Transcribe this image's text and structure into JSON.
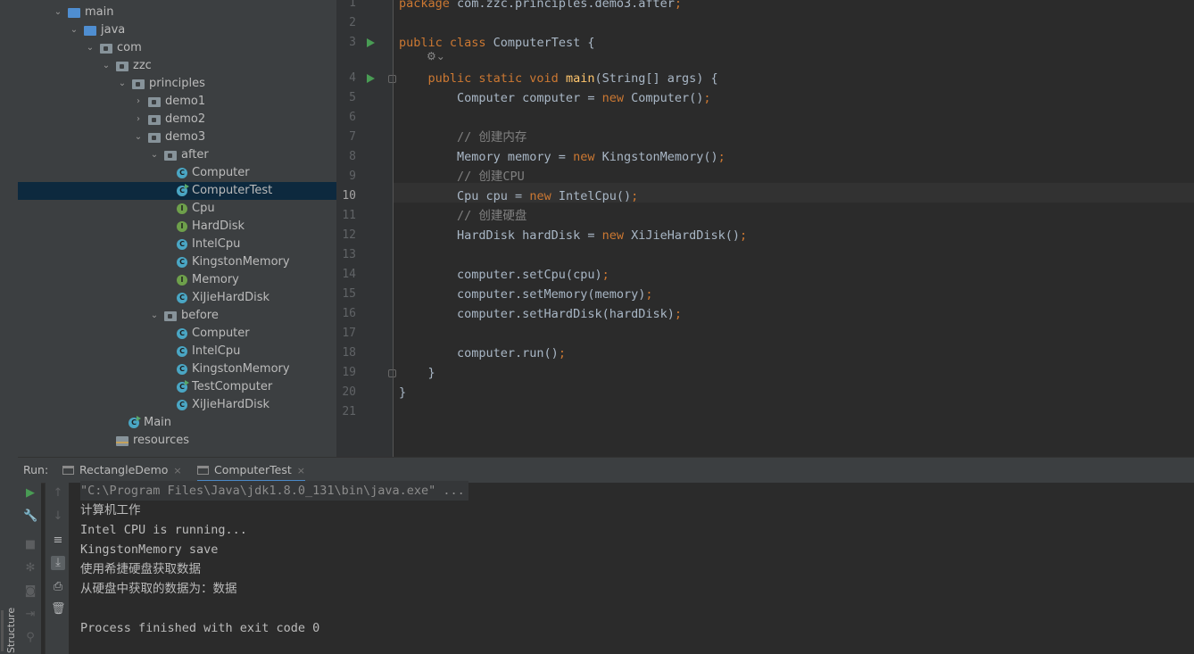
{
  "project_tree": {
    "items": [
      {
        "label": "main",
        "kind": "folder-src",
        "depth": 0,
        "state": "open"
      },
      {
        "label": "java",
        "kind": "folder-src",
        "depth": 1,
        "state": "open"
      },
      {
        "label": "com",
        "kind": "folder-pkg",
        "depth": 2,
        "state": "open"
      },
      {
        "label": "zzc",
        "kind": "folder-pkg",
        "depth": 3,
        "state": "open"
      },
      {
        "label": "principles",
        "kind": "folder-pkg",
        "depth": 4,
        "state": "open"
      },
      {
        "label": "demo1",
        "kind": "folder-pkg",
        "depth": 5,
        "state": "closed"
      },
      {
        "label": "demo2",
        "kind": "folder-pkg",
        "depth": 5,
        "state": "closed"
      },
      {
        "label": "demo3",
        "kind": "folder-pkg",
        "depth": 5,
        "state": "open"
      },
      {
        "label": "after",
        "kind": "folder-pkg",
        "depth": 6,
        "state": "open"
      },
      {
        "label": "Computer",
        "kind": "class",
        "depth": 7
      },
      {
        "label": "ComputerTest",
        "kind": "class-run",
        "depth": 7,
        "selected": true
      },
      {
        "label": "Cpu",
        "kind": "interface",
        "depth": 7
      },
      {
        "label": "HardDisk",
        "kind": "interface",
        "depth": 7
      },
      {
        "label": "IntelCpu",
        "kind": "class",
        "depth": 7
      },
      {
        "label": "KingstonMemory",
        "kind": "class",
        "depth": 7
      },
      {
        "label": "Memory",
        "kind": "interface",
        "depth": 7
      },
      {
        "label": "XiJieHardDisk",
        "kind": "class",
        "depth": 7
      },
      {
        "label": "before",
        "kind": "folder-pkg",
        "depth": 6,
        "state": "open"
      },
      {
        "label": "Computer",
        "kind": "class",
        "depth": 7
      },
      {
        "label": "IntelCpu",
        "kind": "class",
        "depth": 7
      },
      {
        "label": "KingstonMemory",
        "kind": "class",
        "depth": 7
      },
      {
        "label": "TestComputer",
        "kind": "class-run",
        "depth": 7
      },
      {
        "label": "XiJieHardDisk",
        "kind": "class",
        "depth": 7
      },
      {
        "label": "Main",
        "kind": "class-run",
        "depth": 4
      },
      {
        "label": "resources",
        "kind": "folder-res",
        "depth": 3
      }
    ]
  },
  "editor": {
    "current_line": 10,
    "lines": [
      {
        "n": "1",
        "tokens": [
          [
            "kw",
            "package "
          ],
          [
            "pl",
            "com.zzc.principles.demo3.after"
          ],
          [
            "sm",
            ";"
          ]
        ]
      },
      {
        "n": "2",
        "tokens": []
      },
      {
        "n": "3",
        "tokens": [
          [
            "kw",
            "public class "
          ],
          [
            "pl",
            "ComputerTest {"
          ]
        ]
      },
      {
        "n": "",
        "tokens": []
      },
      {
        "n": "4",
        "tokens": [
          [
            "pl",
            "    "
          ],
          [
            "kw",
            "public static void "
          ],
          [
            "fn",
            "main"
          ],
          [
            "pl",
            "(String[] args) {"
          ]
        ]
      },
      {
        "n": "5",
        "tokens": [
          [
            "pl",
            "        Computer computer = "
          ],
          [
            "kw",
            "new "
          ],
          [
            "pl",
            "Computer()"
          ],
          [
            "sm",
            ";"
          ]
        ]
      },
      {
        "n": "6",
        "tokens": []
      },
      {
        "n": "7",
        "tokens": [
          [
            "cm",
            "        // 创建内存"
          ]
        ]
      },
      {
        "n": "8",
        "tokens": [
          [
            "pl",
            "        Memory memory = "
          ],
          [
            "kw",
            "new "
          ],
          [
            "pl",
            "KingstonMemory()"
          ],
          [
            "sm",
            ";"
          ]
        ]
      },
      {
        "n": "9",
        "tokens": [
          [
            "cm",
            "        // 创建CPU"
          ]
        ]
      },
      {
        "n": "10",
        "tokens": [
          [
            "pl",
            "        Cpu cpu = "
          ],
          [
            "kw",
            "new "
          ],
          [
            "pl",
            "IntelCpu()"
          ],
          [
            "sm",
            ";"
          ]
        ]
      },
      {
        "n": "11",
        "tokens": [
          [
            "cm",
            "        // 创建硬盘"
          ]
        ]
      },
      {
        "n": "12",
        "tokens": [
          [
            "pl",
            "        HardDisk hardDisk = "
          ],
          [
            "kw",
            "new "
          ],
          [
            "pl",
            "XiJieHardDisk()"
          ],
          [
            "sm",
            ";"
          ]
        ]
      },
      {
        "n": "13",
        "tokens": []
      },
      {
        "n": "14",
        "tokens": [
          [
            "pl",
            "        computer.setCpu(cpu)"
          ],
          [
            "sm",
            ";"
          ]
        ]
      },
      {
        "n": "15",
        "tokens": [
          [
            "pl",
            "        computer.setMemory(memory)"
          ],
          [
            "sm",
            ";"
          ]
        ]
      },
      {
        "n": "16",
        "tokens": [
          [
            "pl",
            "        computer.setHardDisk(hardDisk)"
          ],
          [
            "sm",
            ";"
          ]
        ]
      },
      {
        "n": "17",
        "tokens": []
      },
      {
        "n": "18",
        "tokens": [
          [
            "pl",
            "        computer.run()"
          ],
          [
            "sm",
            ";"
          ]
        ]
      },
      {
        "n": "19",
        "tokens": [
          [
            "pl",
            "    }"
          ]
        ]
      },
      {
        "n": "20",
        "tokens": [
          [
            "pl",
            "}"
          ]
        ]
      },
      {
        "n": "21",
        "tokens": []
      }
    ]
  },
  "run_panel": {
    "label": "Run:",
    "tabs": [
      {
        "label": "RectangleDemo",
        "close": "×",
        "active": false
      },
      {
        "label": "ComputerTest",
        "close": "×",
        "active": true
      }
    ],
    "console": [
      {
        "text": "\"C:\\Program Files\\Java\\jdk1.8.0_131\\bin\\java.exe\" ...",
        "kind": "cmd"
      },
      {
        "text": "计算机工作",
        "kind": "out"
      },
      {
        "text": "Intel CPU is running...",
        "kind": "out"
      },
      {
        "text": "KingstonMemory save",
        "kind": "out"
      },
      {
        "text": "使用希捷硬盘获取数据",
        "kind": "out"
      },
      {
        "text": "从硬盘中获取的数据为：数据",
        "kind": "out"
      },
      {
        "text": "",
        "kind": "out"
      },
      {
        "text": "Process finished with exit code 0",
        "kind": "out"
      }
    ]
  },
  "side_tabs": {
    "structure": "Structure"
  },
  "colors": {
    "keyword": "#cc7832",
    "function": "#ffc66d",
    "comment": "#808080",
    "plain": "#a9b7c6",
    "selection": "#0d293e",
    "run_green": "#499c54"
  }
}
